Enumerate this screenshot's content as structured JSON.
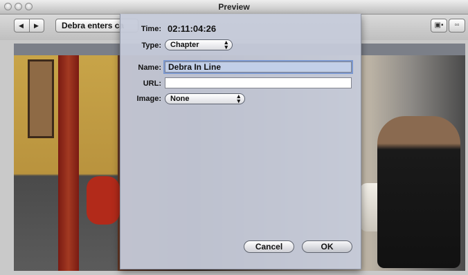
{
  "window": {
    "title": "Preview"
  },
  "toolbar": {
    "marker_name": "Debra enters ca",
    "prev_icon": "◀",
    "next_icon": "▶"
  },
  "dialog": {
    "time_label": "Time:",
    "time_value": "02:11:04:26",
    "type_label": "Type:",
    "type_value": "Chapter",
    "name_label": "Name:",
    "name_value": "Debra In Line",
    "url_label": "URL:",
    "url_value": "",
    "image_label": "Image:",
    "image_value": "None",
    "cancel_label": "Cancel",
    "ok_label": "OK"
  },
  "view_buttons": {
    "left_icon": "▣▪",
    "right_icon": "▫▫"
  }
}
